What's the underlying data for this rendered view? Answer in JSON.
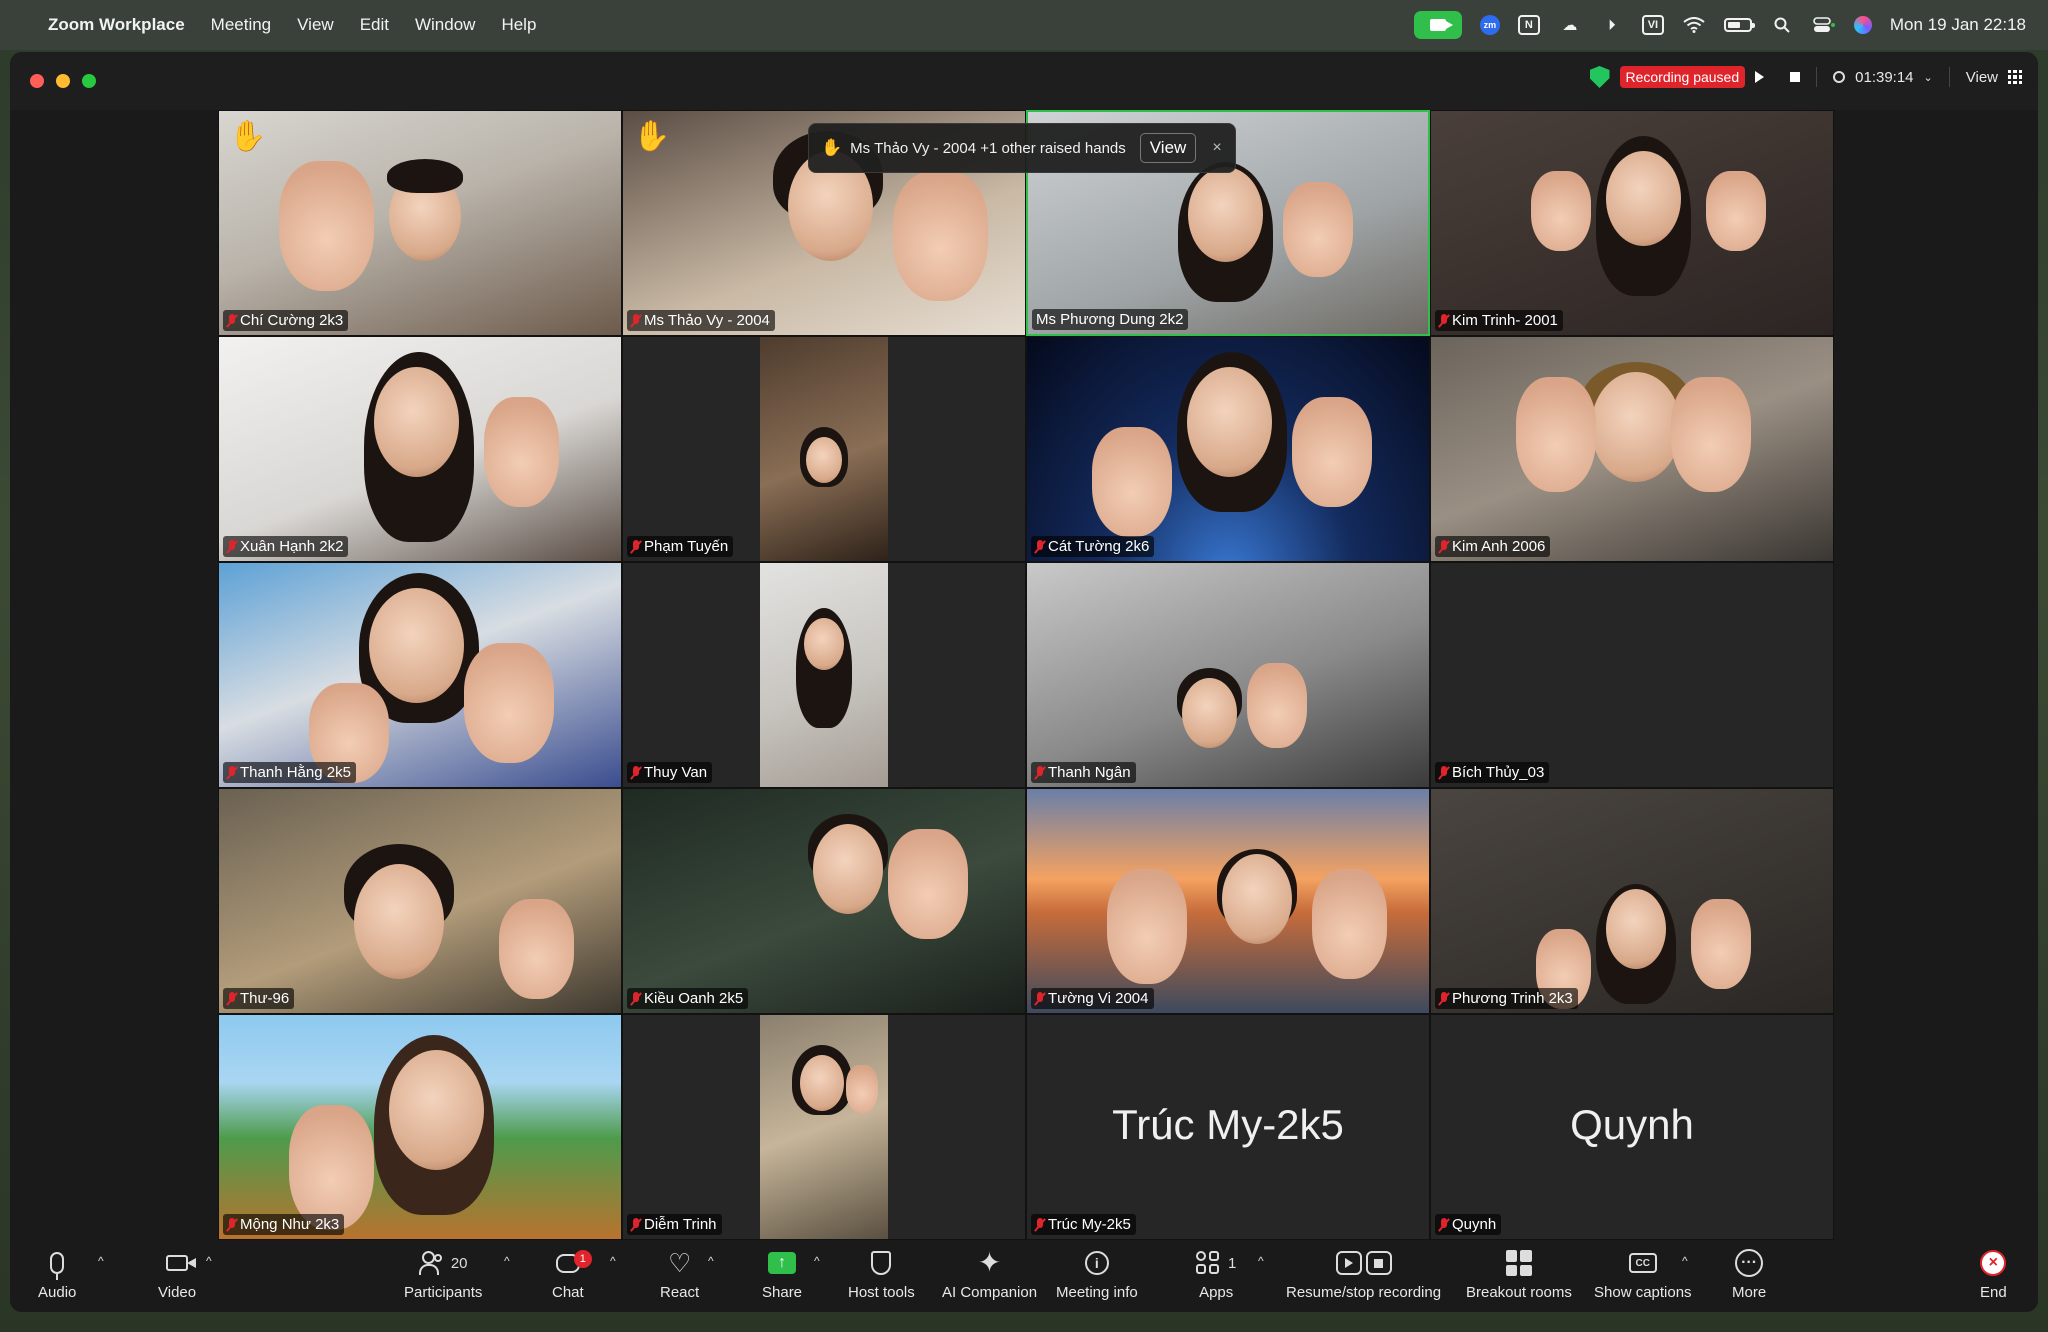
{
  "menubar": {
    "app_name": "Zoom Workplace",
    "items": [
      "Meeting",
      "View",
      "Edit",
      "Window",
      "Help"
    ],
    "status_icons": [
      "zoom-camera-icon",
      "zm-icon",
      "n-icon",
      "cloud-icon",
      "play-circle-icon",
      "vi-input-icon",
      "wifi-icon",
      "battery-icon",
      "search-icon",
      "control-center-icon",
      "siri-icon"
    ],
    "zm_label": "zm",
    "n_label": "N",
    "vi_label": "VI",
    "datetime": "Mon 19 Jan  22:18"
  },
  "window": {
    "recording_status": "Recording paused",
    "timer": "01:39:14",
    "view_label": "View",
    "accent_color": "#2fbf4a",
    "recording_color": "#e0242c"
  },
  "toast": {
    "message": "Ms Thảo Vy - 2004 +1 other raised hands",
    "view_button": "View",
    "close": "×"
  },
  "participants": [
    {
      "name": "Chí Cường 2k3",
      "hand_raised": true
    },
    {
      "name": "Ms Thảo Vy - 2004",
      "hand_raised": true
    },
    {
      "name": "Ms Phương Dung 2k2",
      "active_speaker": true
    },
    {
      "name": "Kim Trinh- 2001"
    },
    {
      "name": "Xuân Hạnh 2k2"
    },
    {
      "name": "Phạm Tuyến"
    },
    {
      "name": "Cát Tường 2k6"
    },
    {
      "name": "Kim Anh 2006"
    },
    {
      "name": "Thanh Hằng 2k5"
    },
    {
      "name": "Thuy Van"
    },
    {
      "name": "Thanh Ngân"
    },
    {
      "name": "Bích Thủy_03"
    },
    {
      "name": "Thư-96"
    },
    {
      "name": "Kiều Oanh 2k5"
    },
    {
      "name": "Tường Vi 2004"
    },
    {
      "name": "Phương Trinh 2k3"
    },
    {
      "name": "Mộng Như 2k3"
    },
    {
      "name": "Diễm Trinh"
    },
    {
      "name": "Trúc My-2k5",
      "video_off_label": "Trúc My-2k5"
    },
    {
      "name": "Quynh",
      "video_off_label": "Quynh"
    }
  ],
  "toolbar": {
    "audio": "Audio",
    "video": "Video",
    "participants": "Participants",
    "participants_count": "20",
    "chat": "Chat",
    "chat_badge": "1",
    "react": "React",
    "share": "Share",
    "host_tools": "Host tools",
    "ai_companion": "AI Companion",
    "meeting_info": "Meeting info",
    "apps": "Apps",
    "apps_count": "1",
    "recording": "Resume/stop recording",
    "breakout": "Breakout rooms",
    "captions": "Show captions",
    "cc_label": "CC",
    "more": "More",
    "end": "End"
  }
}
